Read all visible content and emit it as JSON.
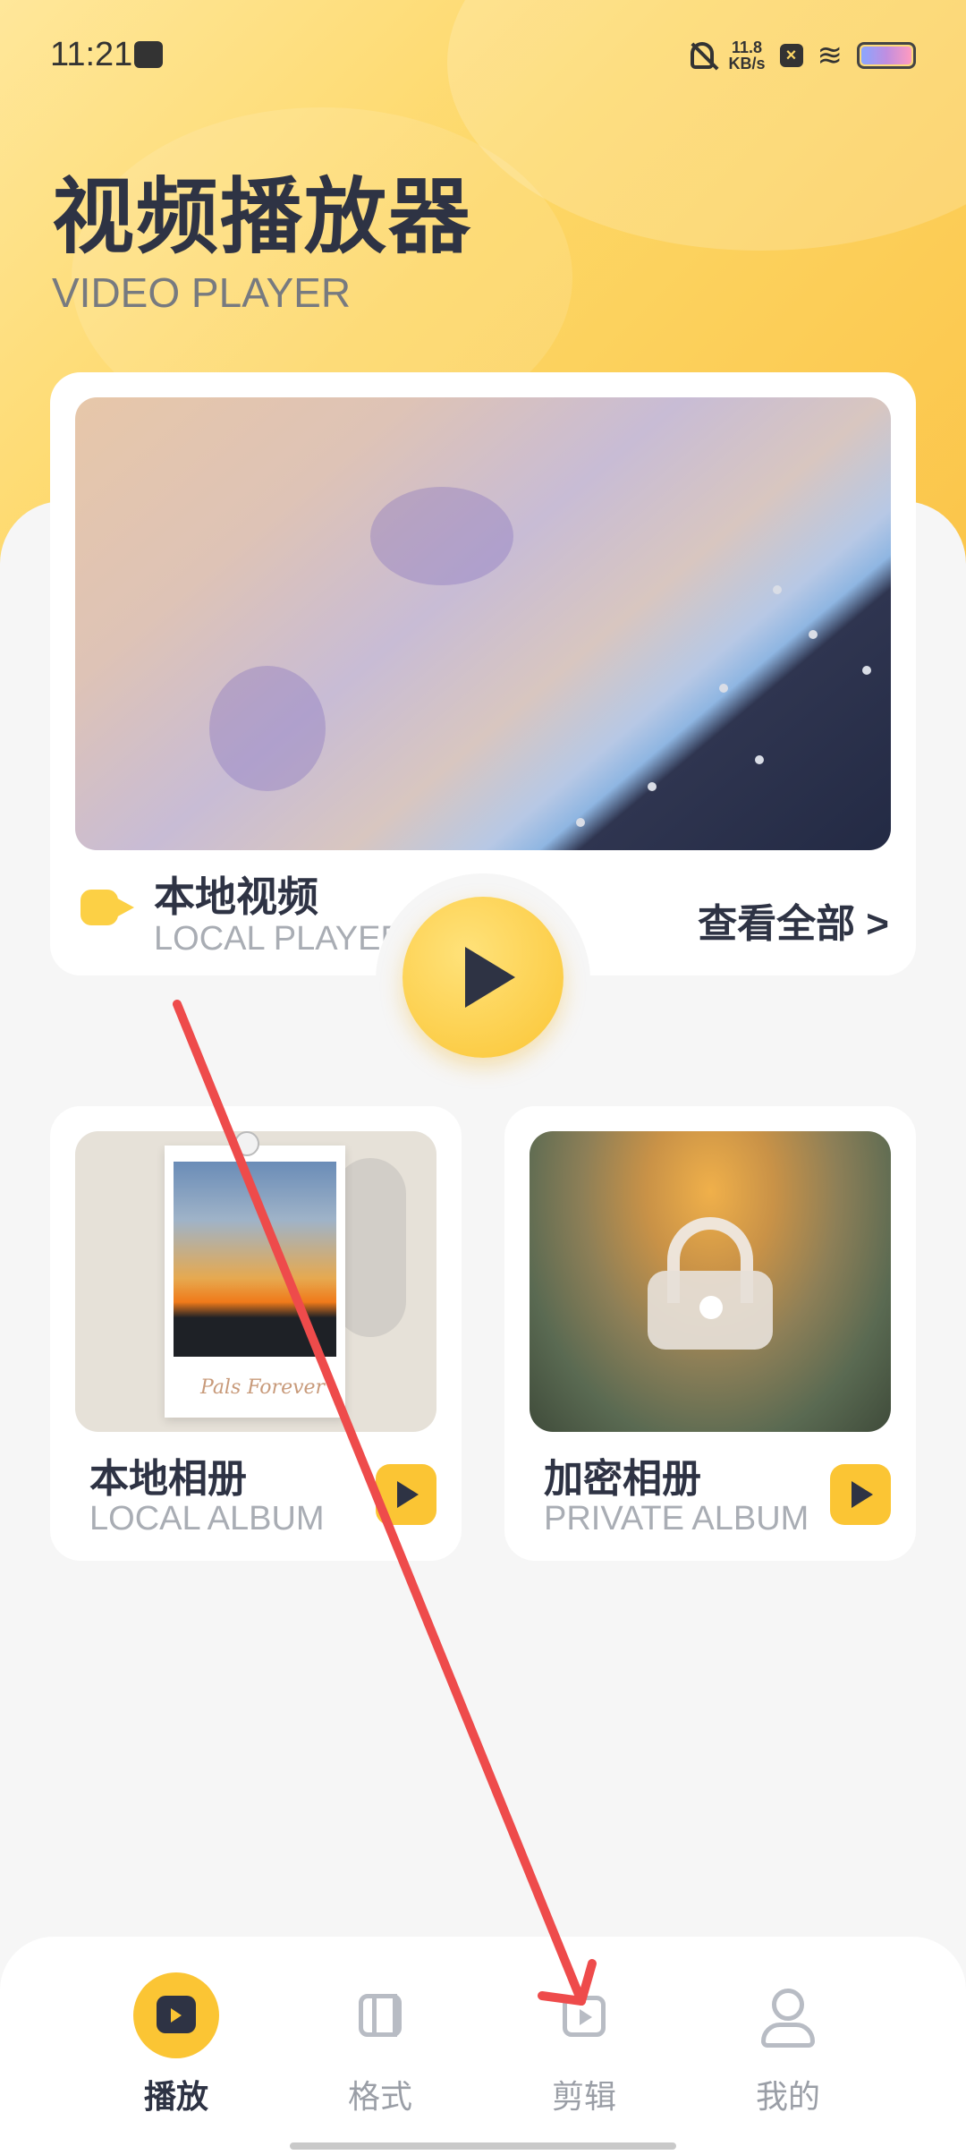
{
  "status_bar": {
    "time": "11:21",
    "net_speed": "11.8",
    "net_unit": "KB/s"
  },
  "header": {
    "title": "视频播放器",
    "subtitle": "VIDEO PLAYER"
  },
  "local_video": {
    "title": "本地视频",
    "subtitle": "LOCAL PLAYER",
    "view_all": "查看全部 >"
  },
  "albums": {
    "local": {
      "title": "本地相册",
      "subtitle": "LOCAL ALBUM",
      "photo_caption": "Pals Forever"
    },
    "private": {
      "title": "加密相册",
      "subtitle": "PRIVATE ALBUM"
    }
  },
  "nav": {
    "items": [
      {
        "label": "播放",
        "icon": "play-clapper-icon",
        "active": true
      },
      {
        "label": "格式",
        "icon": "film-icon",
        "active": false
      },
      {
        "label": "剪辑",
        "icon": "edit-video-icon",
        "active": false
      },
      {
        "label": "我的",
        "icon": "person-icon",
        "active": false
      }
    ]
  },
  "colors": {
    "accent": "#fbc534",
    "text_dark": "#2e3344",
    "text_muted": "#a9adb4",
    "annotation_arrow": "#ee4b4b"
  }
}
